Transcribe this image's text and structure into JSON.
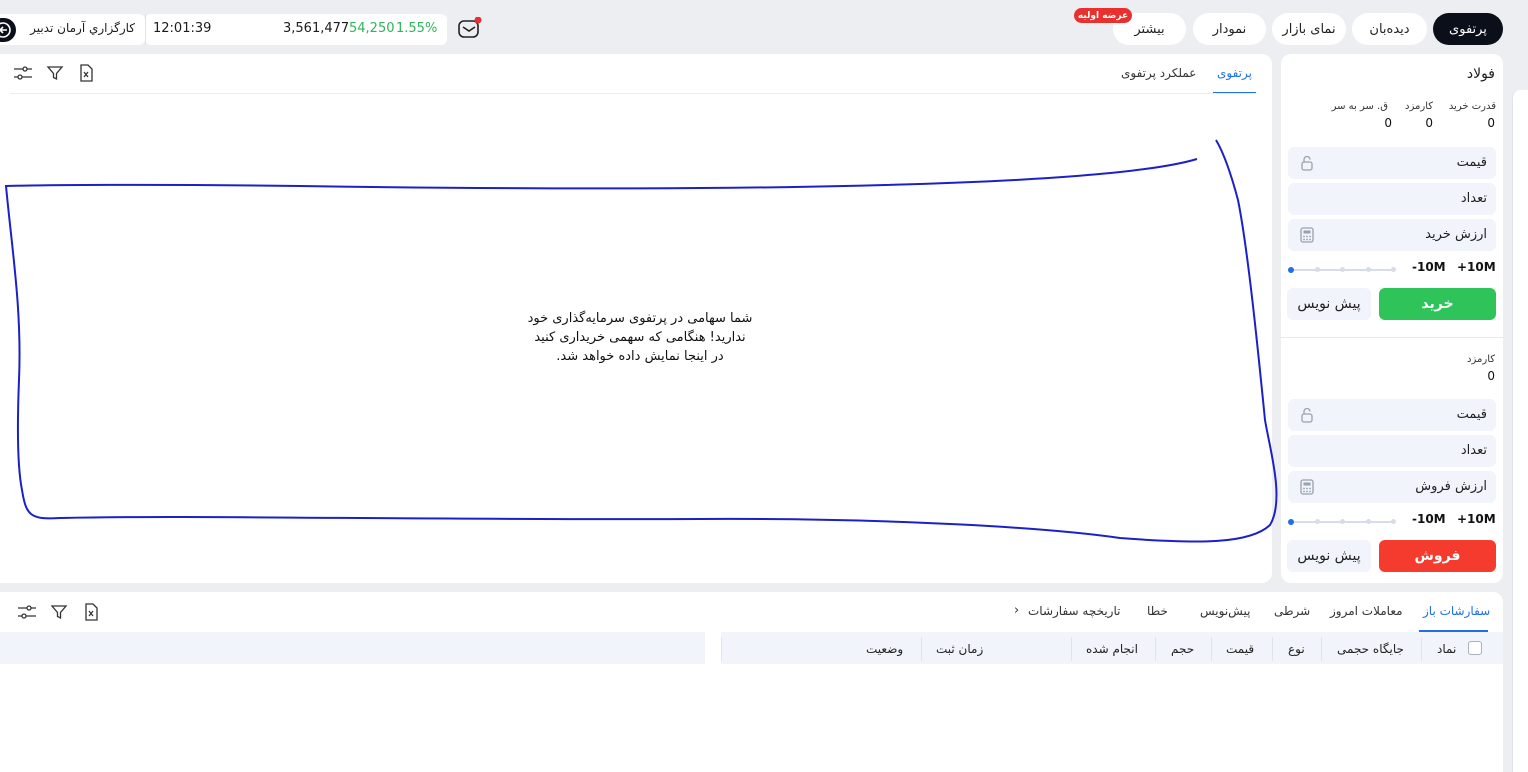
{
  "nav": {
    "items": [
      "پرتفوی",
      "دیده‌بان",
      "نمای بازار",
      "نمودار",
      "بیشتر"
    ],
    "badge": "عرضه اولیه"
  },
  "ticker": {
    "index_value": "3,561,477",
    "change": "54,250",
    "change_pct": "1.55%",
    "time": "12:01:39",
    "change_color": "#2fb55a"
  },
  "broker": {
    "name": "كارگزاري آرمان تدبير"
  },
  "order_form": {
    "symbol": "فولاد",
    "buy": {
      "stats": [
        {
          "label": "قدرت خرید",
          "value": "0"
        },
        {
          "label": "کارمزد",
          "value": "0"
        },
        {
          "label": "ق. سر به سر",
          "value": "0"
        }
      ],
      "price_label": "قیمت",
      "qty_label": "تعداد",
      "value_label": "ارزش خرید",
      "plus": "+10M",
      "minus": "-10M",
      "submit": "خرید",
      "draft": "پیش نویس",
      "submit_color": "#2fc45a"
    },
    "sell": {
      "fee_label": "کارمزد",
      "fee_value": "0",
      "price_label": "قیمت",
      "qty_label": "تعداد",
      "value_label": "ارزش فروش",
      "plus": "+10M",
      "minus": "-10M",
      "submit": "فروش",
      "draft": "پیش نویس",
      "submit_color": "#f53a2e"
    }
  },
  "portfolio": {
    "tabs": [
      "پرتفوی",
      "عملکرد پرتفوی"
    ],
    "empty_lines": [
      "شما سهامی در پرتفوی سرمایه‌گذاری خود",
      "ندارید! هنگامی که سهمی خریداری کنید",
      "در اینجا نمایش داده خواهد شد."
    ]
  },
  "orders": {
    "tabs": [
      "سفارشات باز",
      "معاملات امروز",
      "شرطی",
      "پیش‌نویس",
      "خطا",
      "تاریخچه سفارشات"
    ],
    "columns": [
      "نماد",
      "جایگاه حجمی",
      "نوع",
      "قیمت",
      "حجم",
      "انجام شده",
      "زمان ثبت",
      "وضعیت"
    ]
  },
  "icons": [
    "settings-sliders-icon",
    "filter-icon",
    "excel-icon",
    "mail-icon",
    "logout-icon",
    "lock-icon",
    "calculator-icon",
    "chevron-right-icon"
  ],
  "accent": "#1e6fe8"
}
